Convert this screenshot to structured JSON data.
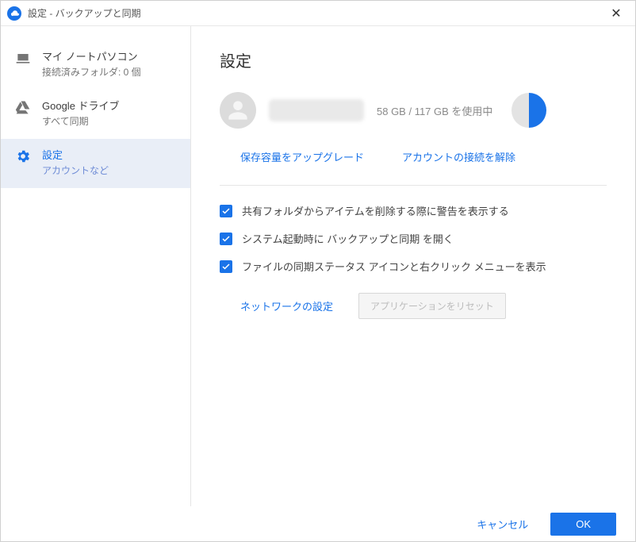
{
  "titlebar": {
    "title": "設定 - バックアップと同期"
  },
  "sidebar": {
    "items": [
      {
        "label": "マイ ノートパソコン",
        "sub": "接続済みフォルダ: 0 個"
      },
      {
        "label": "Google ドライブ",
        "sub": "すべて同期"
      },
      {
        "label": "設定",
        "sub": "アカウントなど"
      }
    ]
  },
  "main": {
    "heading": "設定",
    "storage_text": "58 GB / 117 GB を使用中",
    "links": {
      "upgrade": "保存容量をアップグレード",
      "disconnect": "アカウントの接続を解除"
    },
    "checks": [
      "共有フォルダからアイテムを削除する際に警告を表示する",
      "システム起動時に バックアップと同期 を開く",
      "ファイルの同期ステータス アイコンと右クリック メニューを表示"
    ],
    "network_btn": "ネットワークの設定",
    "reset_btn": "アプリケーションをリセット"
  },
  "footer": {
    "cancel": "キャンセル",
    "ok": "OK"
  },
  "colors": {
    "accent": "#1a73e8"
  }
}
